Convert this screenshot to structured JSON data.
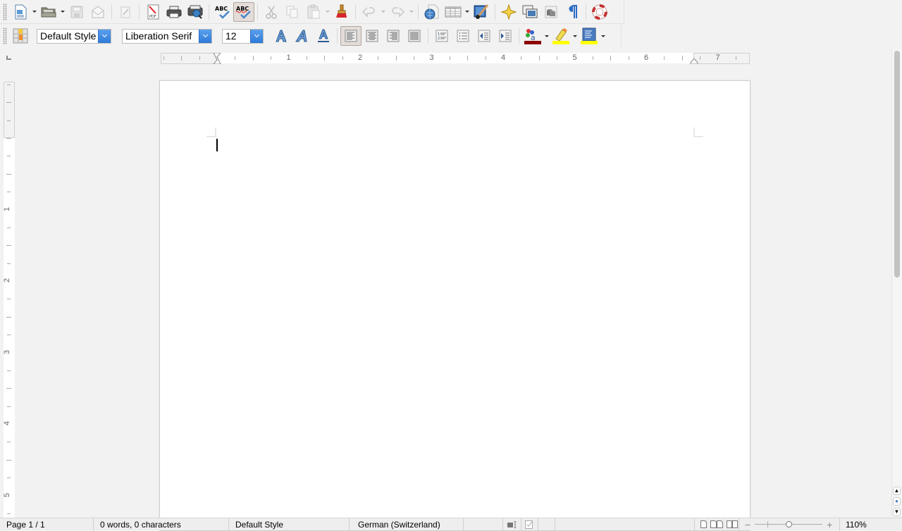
{
  "toolbar_standard": {
    "buttons": [
      {
        "name": "new-document",
        "tooltip": "New"
      },
      {
        "name": "open",
        "tooltip": "Open"
      },
      {
        "name": "save",
        "tooltip": "Save"
      },
      {
        "name": "email",
        "tooltip": "Document as E-mail"
      },
      {
        "name": "edit-file",
        "tooltip": "Edit File"
      },
      {
        "name": "export-pdf",
        "tooltip": "Export Directly as PDF"
      },
      {
        "name": "print",
        "tooltip": "Print File Directly"
      },
      {
        "name": "print-preview",
        "tooltip": "Print Preview"
      },
      {
        "name": "spelling",
        "tooltip": "Spelling and Grammar"
      },
      {
        "name": "autospellcheck",
        "tooltip": "AutoSpellcheck",
        "pressed": true
      },
      {
        "name": "cut",
        "tooltip": "Cut"
      },
      {
        "name": "copy",
        "tooltip": "Copy"
      },
      {
        "name": "paste",
        "tooltip": "Paste"
      },
      {
        "name": "clone-formatting",
        "tooltip": "Clone Formatting"
      },
      {
        "name": "undo",
        "tooltip": "Undo"
      },
      {
        "name": "redo",
        "tooltip": "Redo"
      },
      {
        "name": "hyperlink",
        "tooltip": "Hyperlink"
      },
      {
        "name": "table",
        "tooltip": "Table"
      },
      {
        "name": "show-draw-functions",
        "tooltip": "Show Draw Functions"
      },
      {
        "name": "navigator",
        "tooltip": "Navigator"
      },
      {
        "name": "gallery",
        "tooltip": "Gallery"
      },
      {
        "name": "data-sources",
        "tooltip": "Data Sources"
      },
      {
        "name": "formatting-marks",
        "tooltip": "Formatting Marks"
      },
      {
        "name": "help",
        "tooltip": "Help"
      }
    ]
  },
  "toolbar_formatting": {
    "paragraph_style": "Default Style",
    "font_name": "Liberation Serif",
    "font_size": "12",
    "alignment_active": "left",
    "font_color": "#8b0000",
    "highlight_color": "#ffff00",
    "background_color": "#ffff00"
  },
  "ruler": {
    "horizontal_labels": [
      "1",
      "2",
      "3",
      "4",
      "5",
      "6",
      "7"
    ],
    "vertical_labels": [
      "1",
      "2",
      "3",
      "4",
      "5"
    ]
  },
  "statusbar": {
    "page": "Page 1 / 1",
    "word_count": "0 words, 0 characters",
    "page_style": "Default Style",
    "language": "German (Switzerland)",
    "zoom_percent": "110%",
    "zoom_level": 110
  },
  "navigation": {
    "prev_page": "▲",
    "browse": "●",
    "next_page": "▼"
  }
}
